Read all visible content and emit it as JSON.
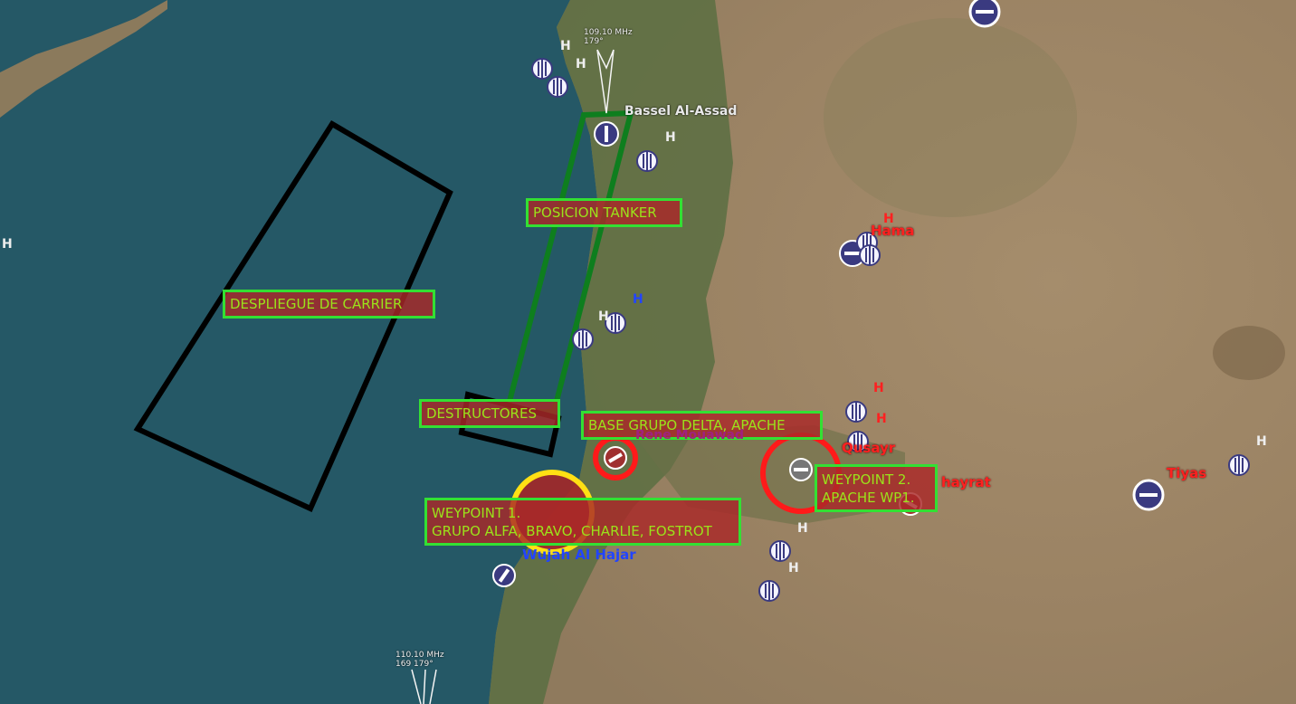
{
  "zones": {
    "carrier": "DESPLIEGUE DE CARRIER",
    "tanker": "POSICION TANKER",
    "destroyers": "DESTRUCTORES",
    "base_delta": "BASE GRUPO DELTA, APACHE",
    "wp1_line1": "WEYPOINT 1.",
    "wp1_line2": "GRUPO ALFA, BRAVO, CHARLIE, FOSTROT",
    "wp2_line1": "WEYPOINT 2.",
    "wp2_line2": "APACHE WP1."
  },
  "places": {
    "bassel": "Bassel Al-Assad",
    "hama": "Hama",
    "qusayr": "Qusayr",
    "shayrat": "hayrat",
    "tiyas": "Tiyas",
    "rene": "Rene Mouawad",
    "wujah": "Wujah Al Hajar"
  },
  "nav": {
    "top_freq": "109.10 MHz",
    "top_bearing": "179°",
    "bottom_freq": "110.10 MHz",
    "bottom_bearing": "169 179°"
  },
  "heli": "H",
  "colors": {
    "sea": "#255866",
    "land": "#9a8466",
    "coast_green": "#4a6a3a",
    "zone_border": "#33e033",
    "zone_text": "#9be21b",
    "zone_fill": "#aa2828",
    "threat": "#ff1a1a",
    "waypoint_ring": "#ffe014"
  }
}
